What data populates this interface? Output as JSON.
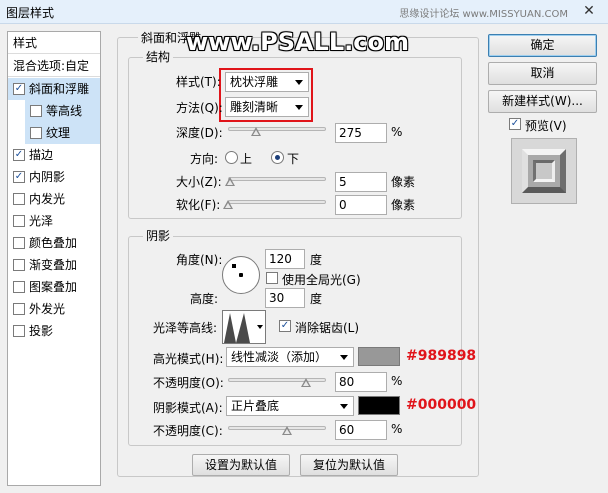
{
  "window": {
    "title": "图层样式",
    "watermark_site": "思缘设计论坛 www.MISSYUAN.COM",
    "close_glyph": "✕"
  },
  "overlay_watermark": "www.PSALL.com",
  "left_panel": {
    "header_styles": "样式",
    "header_blend": "混合选项:自定",
    "items": [
      {
        "label": "斜面和浮雕",
        "checked": true,
        "indent": false,
        "selected": true
      },
      {
        "label": "等高线",
        "checked": false,
        "indent": true,
        "selected": true
      },
      {
        "label": "纹理",
        "checked": false,
        "indent": true,
        "selected": true
      },
      {
        "label": "描边",
        "checked": true,
        "indent": false,
        "selected": false
      },
      {
        "label": "内阴影",
        "checked": true,
        "indent": false,
        "selected": false
      },
      {
        "label": "内发光",
        "checked": false,
        "indent": false,
        "selected": false
      },
      {
        "label": "光泽",
        "checked": false,
        "indent": false,
        "selected": false
      },
      {
        "label": "颜色叠加",
        "checked": false,
        "indent": false,
        "selected": false
      },
      {
        "label": "渐变叠加",
        "checked": false,
        "indent": false,
        "selected": false
      },
      {
        "label": "图案叠加",
        "checked": false,
        "indent": false,
        "selected": false
      },
      {
        "label": "外发光",
        "checked": false,
        "indent": false,
        "selected": false
      },
      {
        "label": "投影",
        "checked": false,
        "indent": false,
        "selected": false
      }
    ]
  },
  "bevel": {
    "group_title": "斜面和浮雕",
    "structure_title": "结构",
    "style_label": "样式(T):",
    "style_value": "枕状浮雕",
    "technique_label": "方法(Q):",
    "technique_value": "雕刻清晰",
    "depth_label": "深度(D):",
    "depth_value": "275",
    "depth_unit": "%",
    "depth_fraction": 0.29,
    "direction_label": "方向:",
    "direction_up": "上",
    "direction_down": "下",
    "direction_selected": "down",
    "size_label": "大小(Z):",
    "size_value": "5",
    "size_unit": "像素",
    "size_fraction": 0.02,
    "soften_label": "软化(F):",
    "soften_value": "0",
    "soften_unit": "像素",
    "soften_fraction": 0.0
  },
  "shading": {
    "title": "阴影",
    "angle_label": "角度(N):",
    "angle_value": "120",
    "angle_unit": "度",
    "global_light_label": "使用全局光(G)",
    "global_light_checked": false,
    "altitude_label": "高度:",
    "altitude_value": "30",
    "altitude_unit": "度",
    "gloss_label": "光泽等高线:",
    "antialias_label": "消除锯齿(L)",
    "antialias_checked": true,
    "highlight_mode_label": "高光模式(H):",
    "highlight_mode_value": "线性减淡（添加）",
    "highlight_color": "#989898",
    "highlight_annotation": "#989898",
    "highlight_opacity_label": "不透明度(O):",
    "highlight_opacity_value": "80",
    "highlight_opacity_unit": "%",
    "highlight_opacity_fraction": 0.8,
    "shadow_mode_label": "阴影模式(A):",
    "shadow_mode_value": "正片叠底",
    "shadow_color": "#000000",
    "shadow_annotation": "#000000",
    "shadow_opacity_label": "不透明度(C):",
    "shadow_opacity_value": "60",
    "shadow_opacity_unit": "%",
    "shadow_opacity_fraction": 0.6
  },
  "footer": {
    "make_default": "设置为默认值",
    "reset_default": "复位为默认值"
  },
  "right": {
    "ok": "确定",
    "cancel": "取消",
    "new_style": "新建样式(W)...",
    "preview_label": "预览(V)",
    "preview_checked": true
  },
  "check_glyph": "✓"
}
